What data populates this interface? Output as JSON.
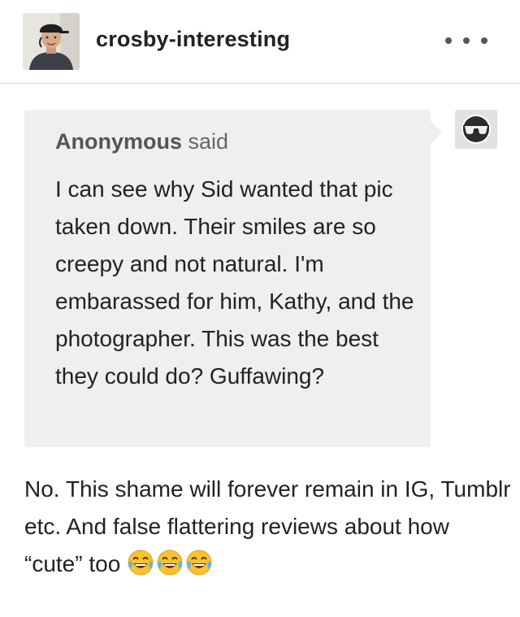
{
  "header": {
    "blog_name": "crosby-interesting",
    "avatar_icon": "user-photo-avatar",
    "more_icon": "more-dots-icon"
  },
  "ask": {
    "asker_name": "Anonymous",
    "said_label": "said",
    "question": "I can see why Sid wanted that pic taken down. Their smiles are so creepy and not natural. I'm embarassed for him, Kathy, and the photographer. This was the best they could do? Guffawing?",
    "anon_avatar_icon": "anonymous-sunglasses-icon"
  },
  "answer": {
    "text": "No. This shame will forever remain in IG, Tumblr etc. And false flattering reviews about how “cute” too",
    "emoji_icon": "face-with-tears-of-joy-icon",
    "emoji_count": 3
  },
  "colors": {
    "bubble_background": "#efefef",
    "text": "#222222",
    "muted_text": "#555555",
    "divider": "#d9d9d9"
  }
}
